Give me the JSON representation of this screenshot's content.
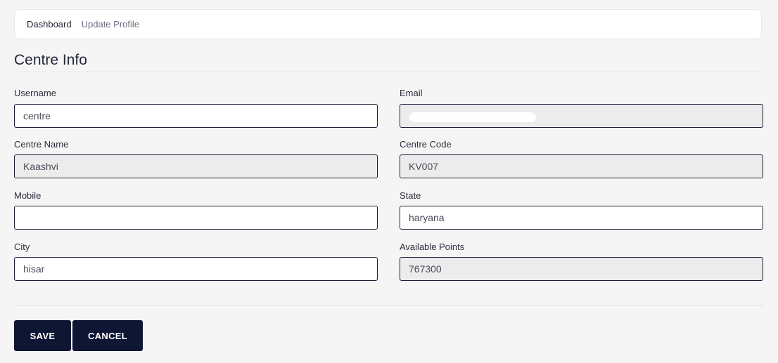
{
  "breadcrumb": {
    "home": "Dashboard",
    "current": "Update Profile"
  },
  "section": {
    "title": "Centre Info"
  },
  "fields": {
    "username": {
      "label": "Username",
      "value": "centre"
    },
    "email": {
      "label": "Email",
      "value": ""
    },
    "centre_name": {
      "label": "Centre Name",
      "value": "Kaashvi"
    },
    "centre_code": {
      "label": "Centre Code",
      "value": "KV007"
    },
    "mobile": {
      "label": "Mobile",
      "value": ""
    },
    "state": {
      "label": "State",
      "value": "haryana"
    },
    "city": {
      "label": "City",
      "value": "hisar"
    },
    "available_points": {
      "label": "Available Points",
      "value": "767300"
    }
  },
  "actions": {
    "save_label": "SAVE",
    "cancel_label": "CANCEL"
  },
  "colors": {
    "primary_button": "#0e1634",
    "input_border": "#1a1f36",
    "readonly_bg": "#ececec",
    "page_bg": "#f5f5f5"
  }
}
